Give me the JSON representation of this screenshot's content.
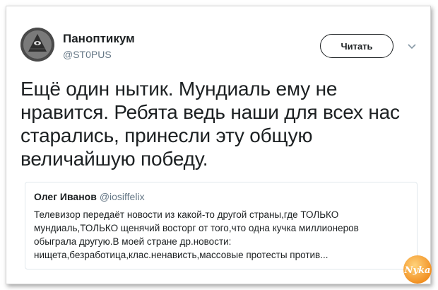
{
  "tweet": {
    "author_name": "Паноптикум",
    "author_handle": "@ST0PUS",
    "follow_label": "Читать",
    "text": "Ещё один нытик. Мундиаль ему не нравится. Ребята ведь наши для всех нас старались, принесли эту общую величайшую победу."
  },
  "quote": {
    "author_name": "Олег Иванов",
    "author_handle": "@iosiffelix",
    "text": "Телевизор передаёт новости из какой-то другой страны,где ТОЛЬКО мундиаль,ТОЛЬКО щенячий восторг от того,что одна кучка миллионеров обыграла другую.В моей стране др.новости: нищета,безработица,клас.ненависть,массовые протесты против..."
  },
  "watermark": {
    "text": "Nyka"
  },
  "colors": {
    "text": "#1c2022",
    "muted": "#657786",
    "border": "#e1e8ed"
  }
}
